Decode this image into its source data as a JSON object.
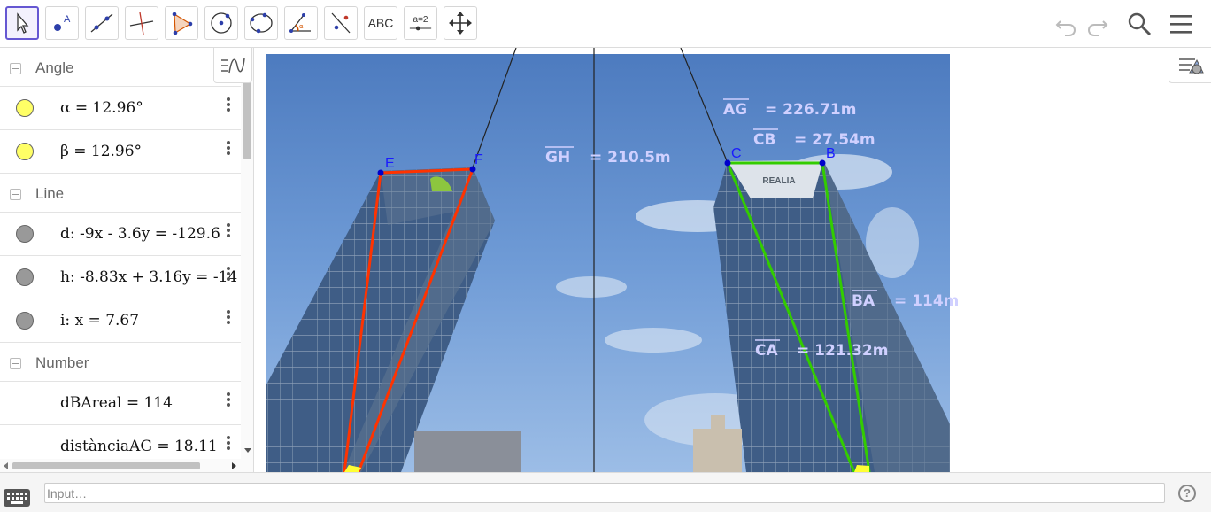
{
  "toolbar": {
    "tools": [
      {
        "name": "move-tool",
        "label": ""
      },
      {
        "name": "point-tool",
        "label": ""
      },
      {
        "name": "line-tool",
        "label": ""
      },
      {
        "name": "perpendicular-line-tool",
        "label": ""
      },
      {
        "name": "polygon-tool",
        "label": ""
      },
      {
        "name": "circle-tool",
        "label": ""
      },
      {
        "name": "circle-through-points-tool",
        "label": ""
      },
      {
        "name": "angle-tool",
        "label": ""
      },
      {
        "name": "reflect-tool",
        "label": ""
      },
      {
        "name": "text-tool",
        "label": "ABC"
      },
      {
        "name": "slider-tool",
        "label": "a=2"
      },
      {
        "name": "move-graphics-tool",
        "label": ""
      }
    ],
    "icons": [
      "undo-icon",
      "redo-icon",
      "search-icon",
      "menu-icon"
    ]
  },
  "algebra": {
    "groups": [
      {
        "label": "Angle"
      },
      {
        "label": "Line"
      },
      {
        "label": "Number"
      }
    ],
    "items": [
      {
        "expr": "α = 12.96°",
        "marble_color": "#ffff66"
      },
      {
        "expr": "β = 12.96°",
        "marble_color": "#ffff66"
      },
      {
        "expr": "d: -9x - 3.6y = -129.6",
        "marble_color": "#999999"
      },
      {
        "expr": "h: -8.83x + 3.16y = -14",
        "marble_color": "#999999"
      },
      {
        "expr": "i: x = 7.67",
        "marble_color": "#999999"
      },
      {
        "expr": "dBAreal = 114",
        "marble_color": ""
      },
      {
        "expr": "distànciaAG = 18.11",
        "marble_color": ""
      }
    ]
  },
  "graphics": {
    "points": [
      {
        "label": "E"
      },
      {
        "label": "F"
      },
      {
        "label": "C"
      },
      {
        "label": "B"
      }
    ],
    "measure_labels": {
      "GH": {
        "name": "GH",
        "value": "= 210.5m"
      },
      "AG": {
        "name": "AG",
        "value": "= 226.71m"
      },
      "CB": {
        "name": "CB",
        "value": "= 27.54m"
      },
      "BA": {
        "name": "BA",
        "value": "= 114m"
      },
      "CA": {
        "name": "CA",
        "value": "= 121.32m"
      }
    },
    "building_sign": "REALIA",
    "colors": {
      "red_polygon": "#ff3300",
      "green_polygon": "#33cc00",
      "point": "#0000cc",
      "measure_text": "#c8c8ff"
    }
  },
  "input": {
    "placeholder": "Input…"
  }
}
